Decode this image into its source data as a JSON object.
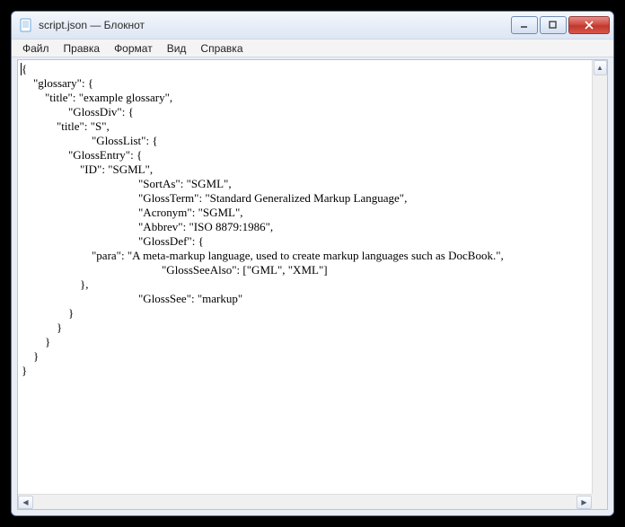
{
  "window": {
    "title": "script.json — Блокнот"
  },
  "menu": {
    "file": "Файл",
    "edit": "Правка",
    "format": "Формат",
    "view": "Вид",
    "help": "Справка"
  },
  "editor": {
    "content": "{\n    \"glossary\": {\n        \"title\": \"example glossary\",\n\t\t\"GlossDiv\": {\n            \"title\": \"S\",\n\t\t\t\"GlossList\": {\n                \"GlossEntry\": {\n                    \"ID\": \"SGML\",\n\t\t\t\t\t\"SortAs\": \"SGML\",\n\t\t\t\t\t\"GlossTerm\": \"Standard Generalized Markup Language\",\n\t\t\t\t\t\"Acronym\": \"SGML\",\n\t\t\t\t\t\"Abbrev\": \"ISO 8879:1986\",\n\t\t\t\t\t\"GlossDef\": {\n                        \"para\": \"A meta-markup language, used to create markup languages such as DocBook.\",\n\t\t\t\t\t\t\"GlossSeeAlso\": [\"GML\", \"XML\"]\n                    },\n\t\t\t\t\t\"GlossSee\": \"markup\"\n                }\n            }\n        }\n    }\n}"
  }
}
